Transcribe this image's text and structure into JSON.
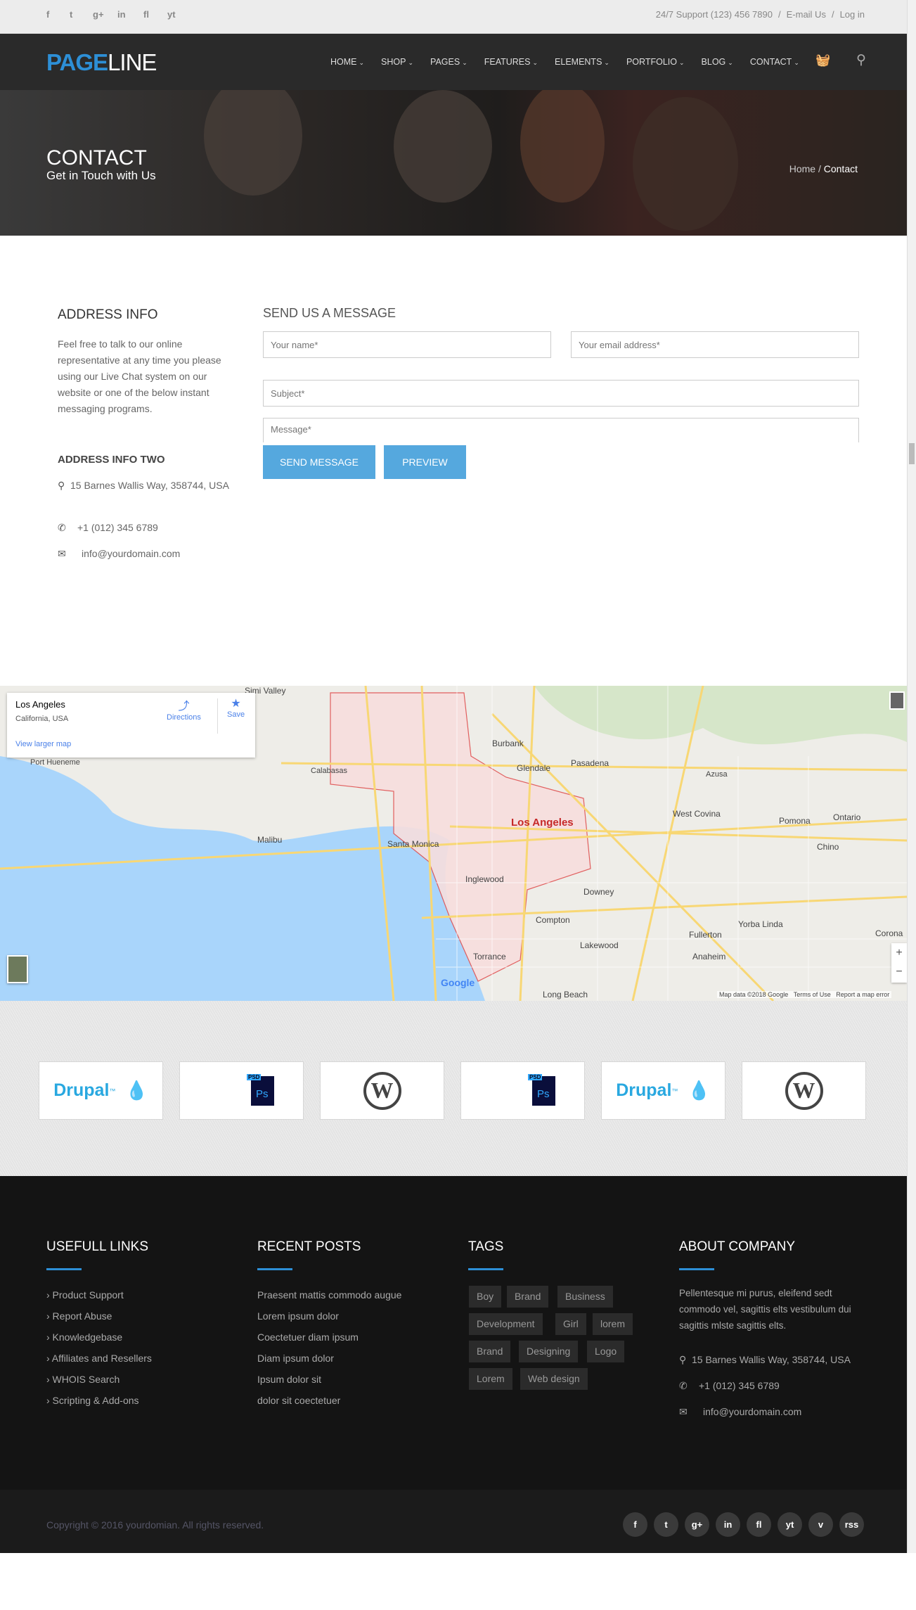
{
  "topbar": {
    "social": [
      "f",
      "t",
      "g+",
      "in",
      "fl",
      "yt"
    ],
    "support": "24/7 Support (123) 456 7890",
    "sep": "/",
    "email": "E-mail Us",
    "login": "Log in"
  },
  "nav": {
    "logo_a": "PAGE",
    "logo_b": "LINE",
    "items": [
      "HOME",
      "SHOP",
      "PAGES",
      "FEATURES",
      "ELEMENTS",
      "PORTFOLIO",
      "BLOG",
      "CONTACT"
    ],
    "caret": "⌄",
    "cart": "🧺",
    "search": "⚲"
  },
  "hero": {
    "title": "CONTACT",
    "subtitle": "Get in Touch with Us",
    "crumb_home": "Home",
    "crumb_sep": " / ",
    "crumb_current": "Contact"
  },
  "address": {
    "title": "ADDRESS INFO",
    "text": "Feel free to talk to our online representative at any time you please using our Live Chat system on our website or one of the below instant messaging programs.",
    "title2": "ADDRESS INFO TWO",
    "street": "15 Barnes Wallis Way, 358744, USA",
    "phone": "+1 (012) 345 6789",
    "email": "info@yourdomain.com"
  },
  "form": {
    "title": "SEND US A MESSAGE",
    "name_ph": "Your name*",
    "email_ph": "Your email address*",
    "subject_ph": "Subject*",
    "message_ph": "Message*",
    "send": "SEND MESSAGE",
    "preview": "PREVIEW"
  },
  "map": {
    "place": "Los Angeles",
    "region": "California, USA",
    "directions": "Directions",
    "save": "Save",
    "larger": "View larger map",
    "labels": [
      "Simi Valley",
      "Burbank",
      "Glendale",
      "Pasadena",
      "Los Angeles",
      "Santa Monica",
      "Malibu",
      "Inglewood",
      "Downey",
      "Compton",
      "Torrance",
      "Lakewood",
      "Anaheim",
      "Fullerton",
      "West Covina",
      "Pomona",
      "Ontario",
      "Chino",
      "Azusa",
      "Calabasas",
      "Port Hueneme",
      "Long Beach",
      "Yorba Linda",
      "Corona"
    ],
    "attribution": "Map data ©2018 Google",
    "terms": "Terms of Use",
    "report": "Report a map error",
    "google": "Google",
    "zoom_in": "+",
    "zoom_out": "−"
  },
  "logos": [
    {
      "name": "Drupal",
      "tm": "™"
    },
    {
      "name": "PSD",
      "ps": "Ps"
    },
    {
      "name": "WordPress",
      "w": "W"
    },
    {
      "name": "PSD",
      "ps": "Ps"
    },
    {
      "name": "Drupal",
      "tm": "™"
    },
    {
      "name": "WordPress",
      "w": "W"
    }
  ],
  "footer": {
    "links_title": "USEFULL LINKS",
    "links": [
      "› Product Support",
      "› Report Abuse",
      "› Knowledgebase",
      "› Affiliates and Resellers",
      "› WHOIS Search",
      "› Scripting & Add-ons"
    ],
    "posts_title": "RECENT POSTS",
    "posts": [
      "Praesent mattis commodo augue",
      "Lorem ipsum dolor",
      "Coectetuer diam ipsum",
      "Diam ipsum dolor",
      "Ipsum dolor sit",
      "dolor sit coectetuer"
    ],
    "tags_title": "TAGS",
    "tags": [
      [
        "Boy",
        "Brand",
        "Business"
      ],
      [
        "Development",
        "Girl",
        "lorem"
      ],
      [
        "Brand",
        "Designing",
        "Logo"
      ],
      [
        "Lorem",
        "Web design"
      ]
    ],
    "about_title": "ABOUT COMPANY",
    "about": "Pellentesque mi purus, eleifend sedt commodo vel, sagittis elts vestibulum dui sagittis mlste sagittis elts.",
    "street": "15 Barnes Wallis Way, 358744, USA",
    "phone": "+1 (012) 345 6789",
    "email": "info@yourdomain.com"
  },
  "bottom": {
    "copyright": "Copyright © 2016 yourdomian. All rights reserved.",
    "social": [
      "f",
      "t",
      "g+",
      "in",
      "fl",
      "yt",
      "v",
      "rss"
    ]
  },
  "colors": {
    "accent": "#2d8fd6",
    "button": "#55a8de",
    "footer": "#141414"
  }
}
